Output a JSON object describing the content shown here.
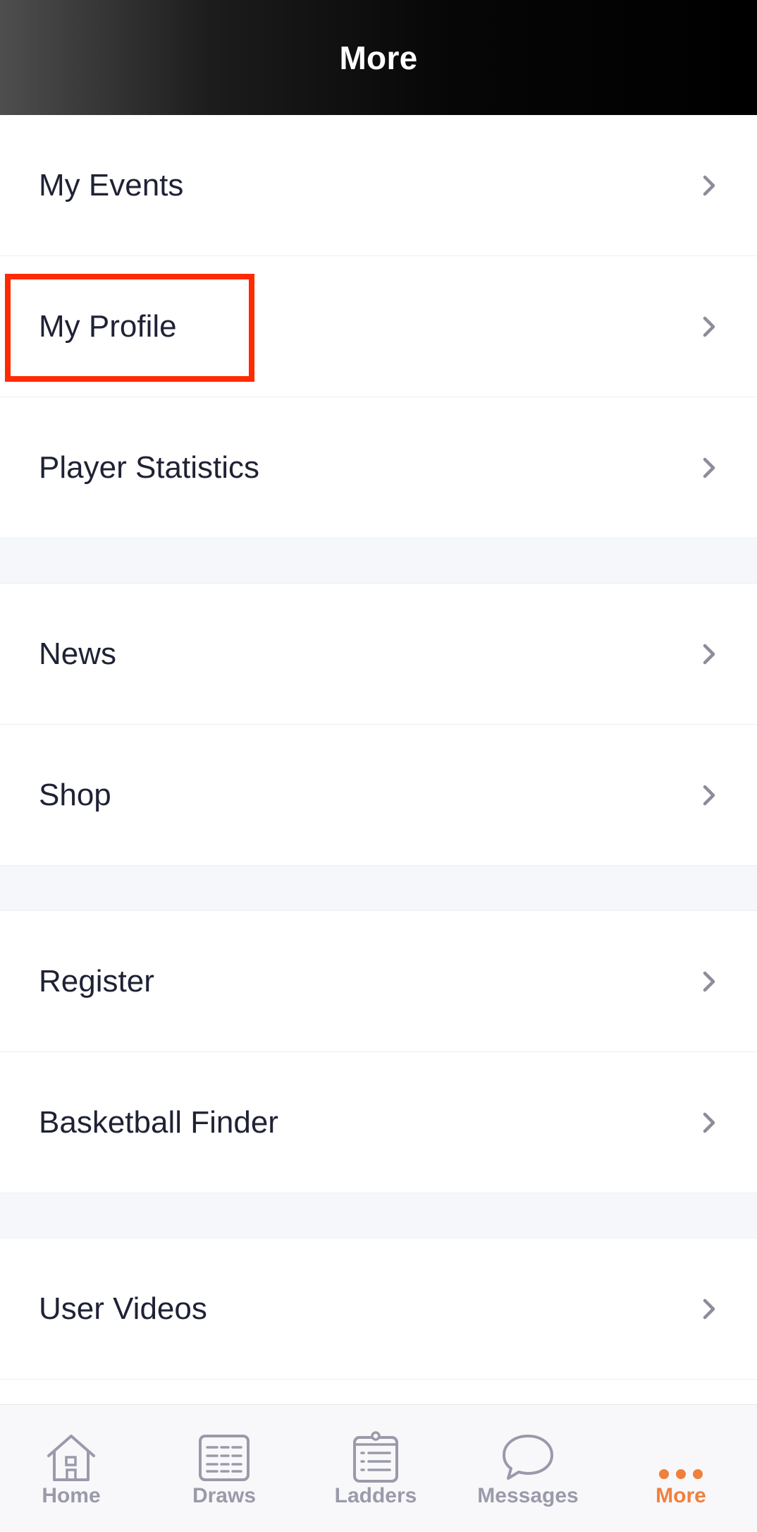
{
  "header": {
    "title": "More"
  },
  "menu": {
    "group1": [
      {
        "label": "My Events"
      },
      {
        "label": "My Profile"
      },
      {
        "label": "Player Statistics"
      }
    ],
    "group2": [
      {
        "label": "News"
      },
      {
        "label": "Shop"
      }
    ],
    "group3": [
      {
        "label": "Register"
      },
      {
        "label": "Basketball Finder"
      }
    ],
    "group4": [
      {
        "label": "User Videos"
      }
    ]
  },
  "tabbar": {
    "tabs": [
      {
        "label": "Home",
        "icon": "home-icon"
      },
      {
        "label": "Draws",
        "icon": "draws-icon"
      },
      {
        "label": "Ladders",
        "icon": "ladders-icon"
      },
      {
        "label": "Messages",
        "icon": "messages-icon"
      },
      {
        "label": "More",
        "icon": "more-icon"
      }
    ],
    "active": "More"
  },
  "colors": {
    "accent": "#f0803c",
    "inactive": "#9a9aaa",
    "highlight": "#ff2a00",
    "text": "#1f2235"
  }
}
